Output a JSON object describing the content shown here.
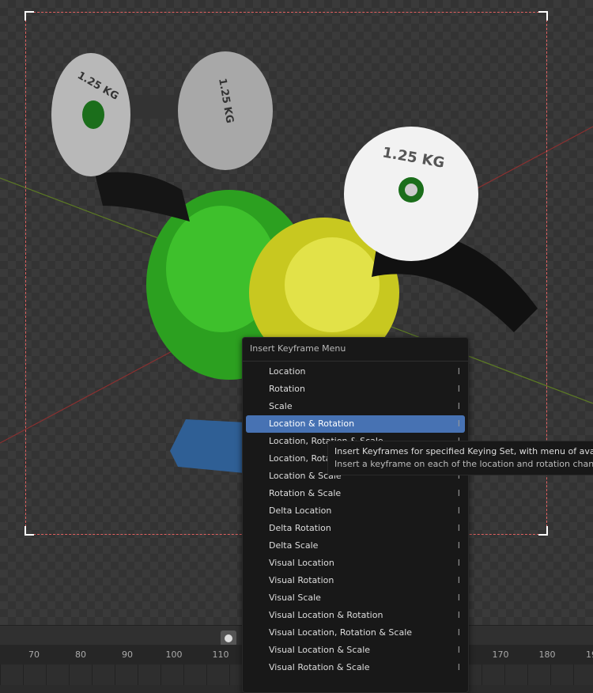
{
  "timeline": {
    "ticks": [
      "70",
      "80",
      "90",
      "100",
      "110",
      "170",
      "180",
      "19"
    ]
  },
  "menu": {
    "title": "Insert Keyframe Menu",
    "items": [
      {
        "label": "Location"
      },
      {
        "label": "Rotation"
      },
      {
        "label": "Scale"
      },
      {
        "label": "Location & Rotation",
        "selected": true
      },
      {
        "label": "Location, Rotation & Scale"
      },
      {
        "label": "Location, Rotation & Delta Scale"
      },
      {
        "label": "Location & Scale"
      },
      {
        "label": "Rotation & Scale"
      },
      {
        "label": "Delta Location"
      },
      {
        "label": "Delta Rotation"
      },
      {
        "label": "Delta Scale"
      },
      {
        "label": "Visual Location"
      },
      {
        "label": "Visual Rotation"
      },
      {
        "label": "Visual Scale"
      },
      {
        "label": "Visual Location & Rotation"
      },
      {
        "label": "Visual Location, Rotation & Scale"
      },
      {
        "label": "Visual Location & Scale"
      },
      {
        "label": "Visual Rotation & Scale"
      }
    ],
    "shortcut_glyph": "I",
    "highlight_color": "#4772b3"
  },
  "tooltip": {
    "line1": "Insert Keyframes for specified Keying Set, with menu of available Keying Sets",
    "line2": "Insert a keyframe on each of the location and rotation channels"
  },
  "scene": {
    "plate_label": "1.25 KG"
  }
}
